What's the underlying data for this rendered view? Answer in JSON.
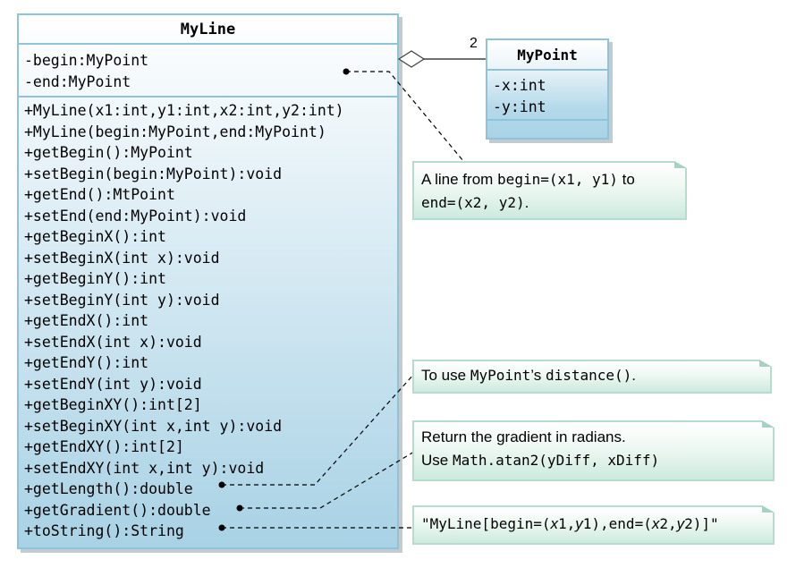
{
  "classes": {
    "myline": {
      "name": "MyLine",
      "attributes": [
        "-begin:MyPoint",
        "-end:MyPoint"
      ],
      "operations": [
        "+MyLine(x1:int,y1:int,x2:int,y2:int)",
        "+MyLine(begin:MyPoint,end:MyPoint)",
        "+getBegin():MyPoint",
        "+setBegin(begin:MyPoint):void",
        "+getEnd():MtPoint",
        "+setEnd(end:MyPoint):void",
        "+getBeginX():int",
        "+setBeginX(int x):void",
        "+getBeginY():int",
        "+setBeginY(int y):void",
        "+getEndX():int",
        "+setEndX(int x):void",
        "+getEndY():int",
        "+setEndY(int y):void",
        "+getBeginXY():int[2]",
        "+setBeginXY(int x,int y):void",
        "+getEndXY():int[2]",
        "+setEndXY(int x,int y):void",
        "+getLength():double",
        "+getGradient():double",
        "+toString():String"
      ]
    },
    "mypoint": {
      "name": "MyPoint",
      "attributes": [
        "-x:int",
        "-y:int"
      ],
      "operations": []
    }
  },
  "association": {
    "type": "aggregation",
    "multiplicity": "2"
  },
  "notes": {
    "note1": {
      "t1": "A line from ",
      "m1": "begin=(x1, y1)",
      "t2": " to",
      "m2": "end=(x2, y2)",
      "t3": "."
    },
    "note2": {
      "t1": "To use ",
      "m1": "MyPoint",
      "t2": "’s ",
      "m2": "distance()",
      "t3": "."
    },
    "note3": {
      "line1": "Return the gradient in radians.",
      "t1": "Use ",
      "m1": "Math.atan2(yDiff, xDiff)"
    },
    "note4": {
      "p1": "\"MyLine[begin=(",
      "i1": "x",
      "p2": "1,",
      "i2": "y",
      "p3": "1),end=(",
      "i3": "x",
      "p4": "2,",
      "i4": "y",
      "p5": "2)]\""
    }
  },
  "colors": {
    "class_border": "#8ec3da",
    "class_fill": "#a9d3e6",
    "note_border": "#b6dccd",
    "note_fill": "#cdeadf"
  }
}
